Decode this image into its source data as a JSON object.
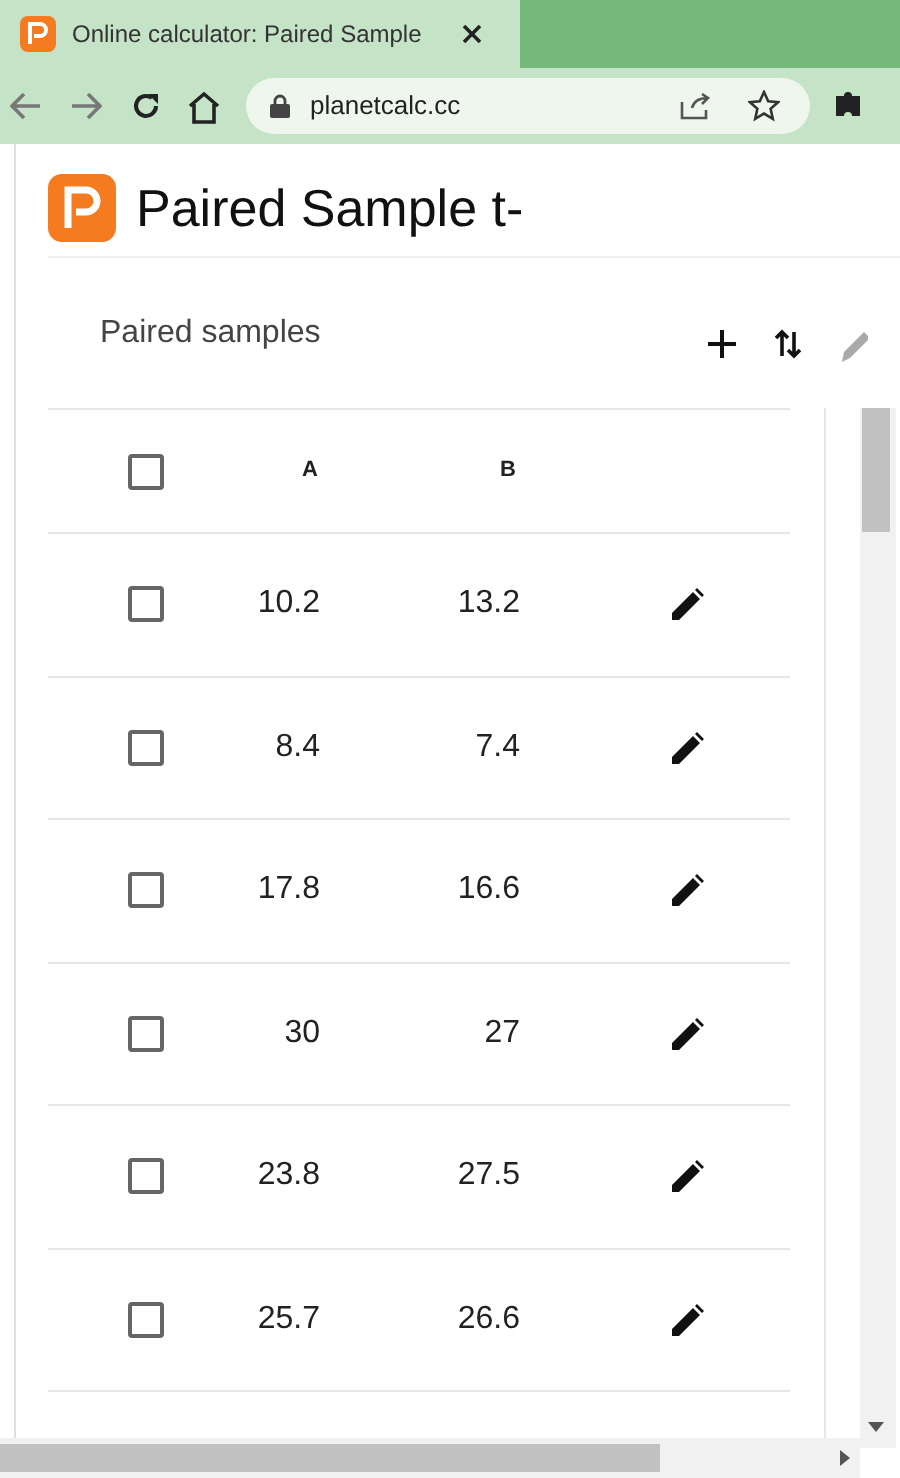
{
  "browser": {
    "tab_title": "Online calculator: Paired Sample",
    "address": "planetcalc.cc"
  },
  "page": {
    "title": "Paired Sample t-"
  },
  "table": {
    "title": "Paired samples",
    "header_checked": false,
    "columns": [
      "A",
      "B"
    ],
    "rows": [
      {
        "a": "10.2",
        "b": "13.2",
        "checked": false
      },
      {
        "a": "8.4",
        "b": "7.4",
        "checked": false
      },
      {
        "a": "17.8",
        "b": "16.6",
        "checked": false
      },
      {
        "a": "30",
        "b": "27",
        "checked": false
      },
      {
        "a": "23.8",
        "b": "27.5",
        "checked": false
      },
      {
        "a": "25.7",
        "b": "26.6",
        "checked": false
      }
    ]
  }
}
